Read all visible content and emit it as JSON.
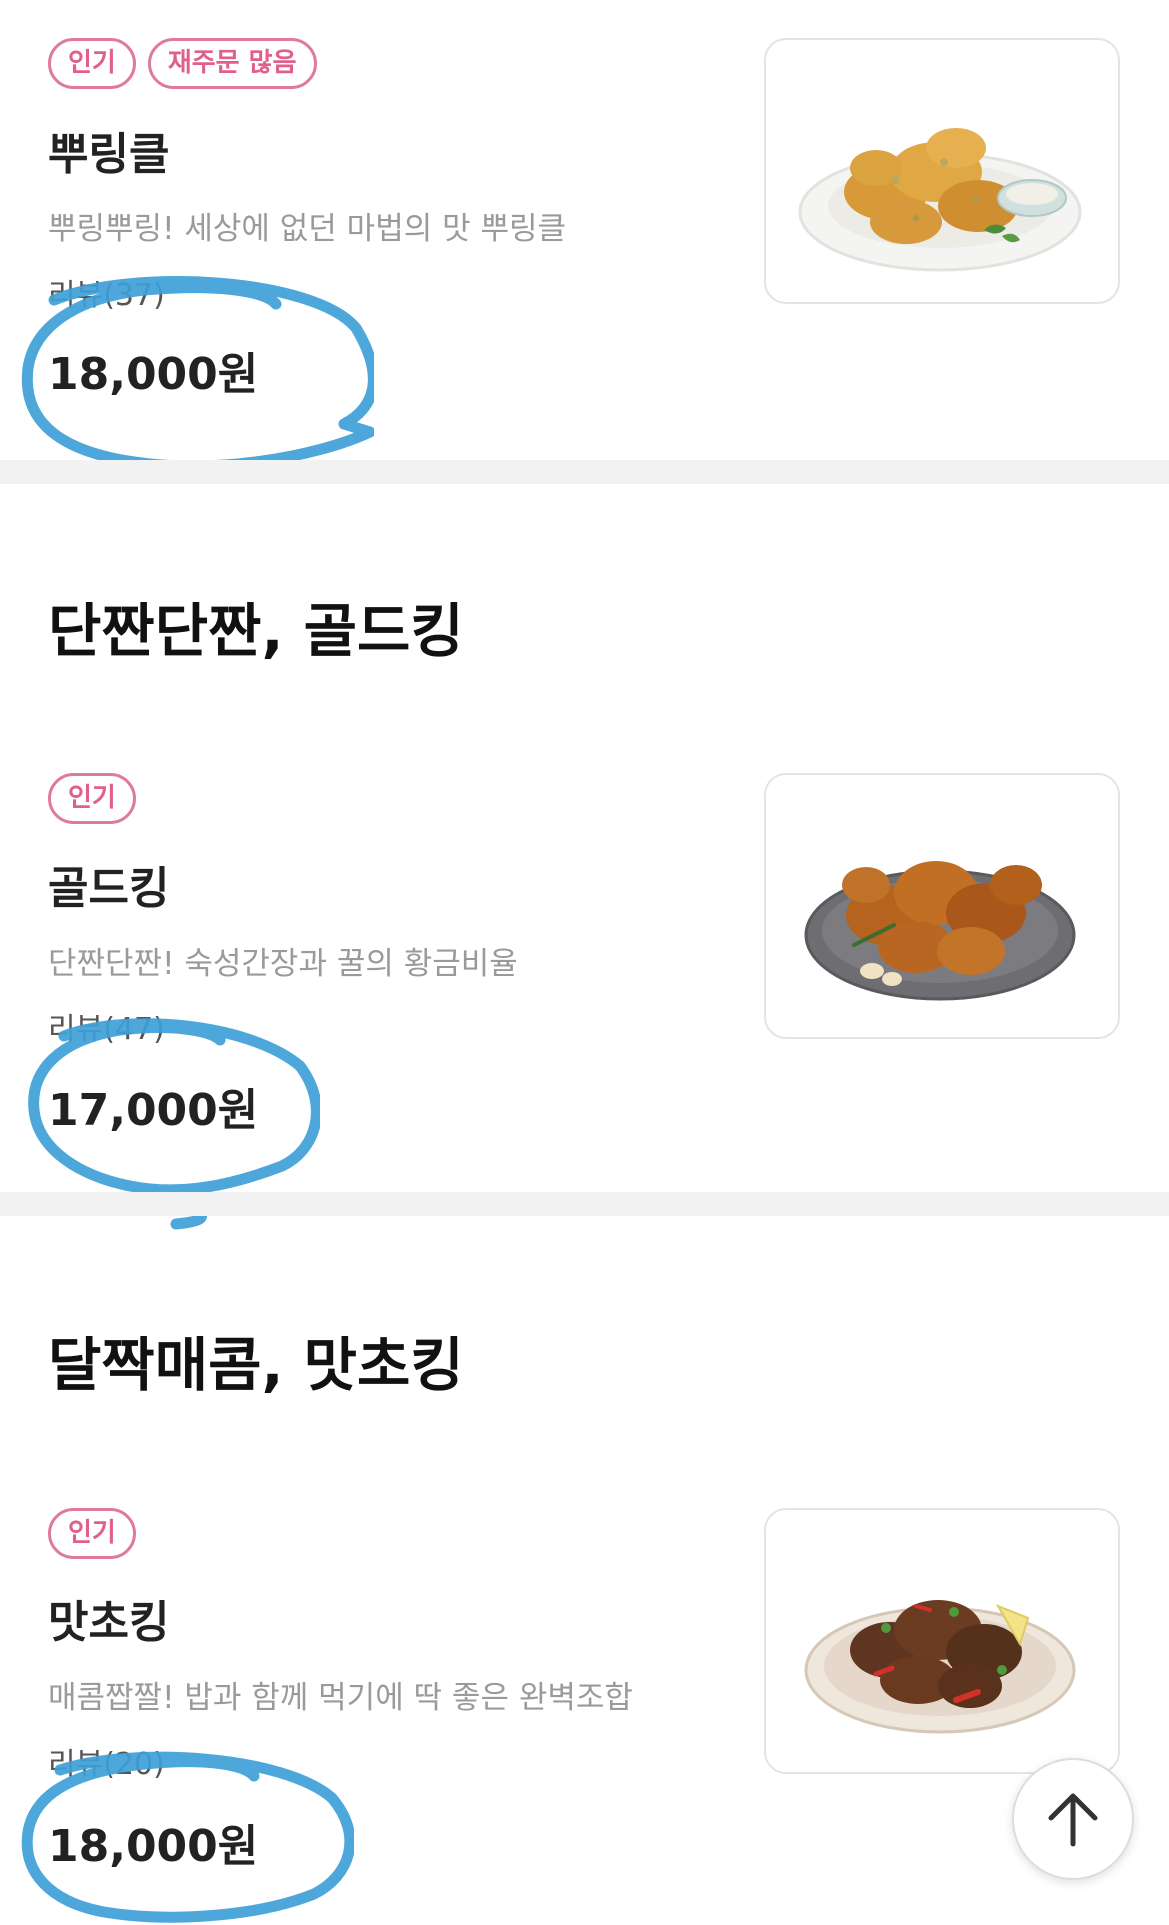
{
  "items": [
    {
      "badges": [
        "인기",
        "재주문 많음"
      ],
      "name": "뿌링클",
      "description": "뿌링뿌링! 세상에 없던 마법의 맛 뿌링클",
      "review": "리뷰(37)",
      "price": "18,000원",
      "image_icon": "seasoned-chicken-with-dip-image"
    },
    {
      "badges": [
        "인기"
      ],
      "name": "골드킹",
      "description": "단짠단짠! 숙성간장과 꿀의 황금비율",
      "review": "리뷰(47)",
      "price": "17,000원",
      "image_icon": "soy-honey-chicken-image"
    },
    {
      "badges": [
        "인기"
      ],
      "name": "맛초킹",
      "description": "매콤짭짤! 밥과 함께 먹기에 딱 좋은 완벽조합",
      "review": "리뷰(20)",
      "price": "18,000원",
      "image_icon": "spicy-chicken-image"
    }
  ],
  "sections": [
    {
      "title": "단짠단짠, 골드킹"
    },
    {
      "title": "달짝매콤, 맛초킹"
    }
  ],
  "annotation": {
    "color": "#3ea0d8",
    "shape": "hand-drawn circle around price"
  },
  "scroll_top_icon": "arrow-up-icon",
  "colors": {
    "badge": "#e0608a",
    "divider": "#f2f2f2"
  }
}
